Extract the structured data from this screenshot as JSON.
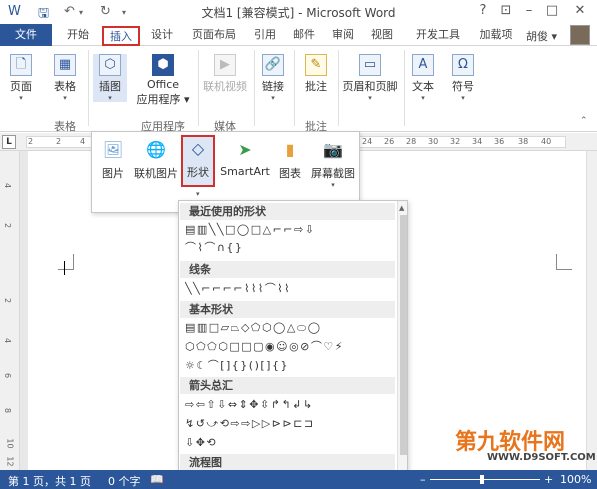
{
  "titlebar": {
    "title": "文档1 [兼容模式] - Microsoft Word",
    "help": "?",
    "restore": "⊡",
    "minimize": "–",
    "maximize": "□",
    "close": "✕",
    "qa_save": "🖫",
    "qa_undo": "↶",
    "qa_undo_arrow": "▾",
    "qa_redo": "↻",
    "qa_customize": "▾"
  },
  "tabs": {
    "file": "文件",
    "home": "开始",
    "insert": "插入",
    "design": "设计",
    "layout": "页面布局",
    "references": "引用",
    "mailings": "邮件",
    "review": "审阅",
    "view": "视图",
    "developer": "开发工具",
    "addins": "加载项",
    "user": "胡俊 ▾"
  },
  "ribbon": {
    "pages": "页面",
    "table": "表格",
    "illustrations": "插图",
    "office_apps_1": "Office",
    "office_apps_2": "应用程序 ▾",
    "online_video": "联机视频",
    "link": "链接",
    "comment": "批注",
    "header_footer": "页眉和页脚",
    "text": "文本",
    "symbols": "符号",
    "grp_tables": "表格",
    "grp_apps": "应用程序",
    "grp_media": "媒体",
    "grp_comments": "批注"
  },
  "illustrations_menu": {
    "picture": "图片",
    "online_picture": "联机图片",
    "shapes": "形状",
    "smartart": "SmartArt",
    "chart": "图表",
    "screenshot": "屏幕截图"
  },
  "shapes_gallery": {
    "recent_header": "最近使用的形状",
    "recent_row1": "▤▥╲╲□◯□△⌐⌐⇨⇩",
    "recent_row2": "⌒⌇⌒∩{}",
    "lines_header": "线条",
    "lines_row1": "╲╲⌐⌐⌐⌐⌇⌇⌇⌒⌇⌇",
    "basic_header": "基本形状",
    "basic_row1": "▤▥□▱⏢◇⬠⬡◯△⬭◯",
    "basic_row2": "⬡⬠⬠⬡□□▢◉☺◎⊘⌒♡⚡",
    "basic_row3": "☼☾⌒[]{}()[]{}",
    "arrows_header": "箭头总汇",
    "arrows_row1": "⇨⇦⇧⇩⇔⇕✥⇳↱↰↲↳",
    "arrows_row2": "↯↺⤻⟲⇨⇨▷▷⊳⊳⊏⊐",
    "arrows_row3": "⇩✥⟲",
    "flow_header": "流程图",
    "flow_row1": "□▢◇▱□▭▯⌂⬭◯▭▽"
  },
  "ruler": {
    "corner": "L",
    "h_nums": [
      "2",
      "2",
      "4",
      "24",
      "26",
      "28",
      "30",
      "32",
      "34",
      "36",
      "38",
      "40"
    ],
    "v_nums": [
      "4",
      "2",
      "2",
      "4",
      "6",
      "8",
      "10",
      "12"
    ]
  },
  "status": {
    "page": "第 1 页，共 1 页",
    "words": "0 个字",
    "zoom": "100%",
    "zoom_minus": "–",
    "zoom_plus": "+"
  },
  "watermark": {
    "logo": "第九软件网",
    "url": "WWW.D9SOFT.COM"
  }
}
